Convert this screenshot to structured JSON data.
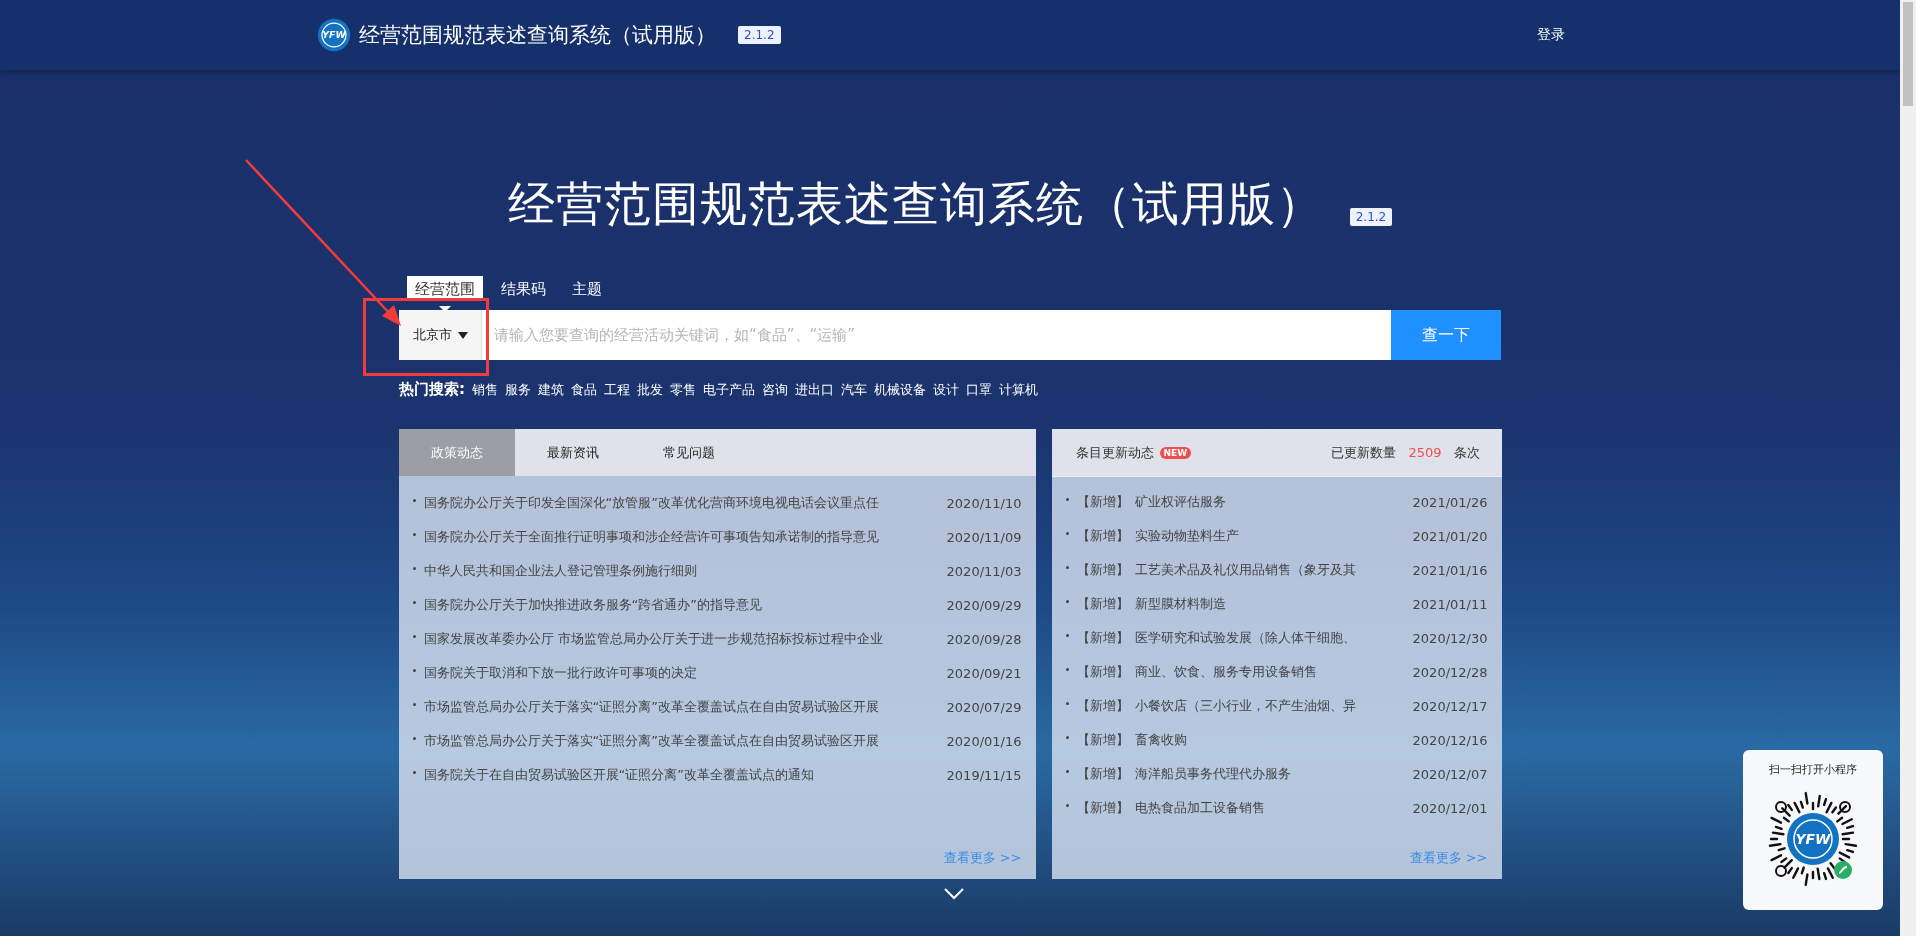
{
  "header": {
    "logo_text": "YFW",
    "title": "经营范围规范表述查询系统（试用版）",
    "version": "2.1.2",
    "login": "登录"
  },
  "hero": {
    "title": "经营范围规范表述查询系统（试用版）",
    "version": "2.1.2"
  },
  "search_tabs": [
    {
      "label": "经营范围",
      "selected": true
    },
    {
      "label": "结果码",
      "selected": false
    },
    {
      "label": "主题",
      "selected": false
    }
  ],
  "search": {
    "city": "北京市",
    "placeholder": "请输入您要查询的经营活动关键词，如“食品”、“运输”",
    "button": "查一下"
  },
  "hot_search": {
    "label": "热门搜索:",
    "keywords": [
      "销售",
      "服务",
      "建筑",
      "食品",
      "工程",
      "批发",
      "零售",
      "电子产品",
      "咨询",
      "进出口",
      "汽车",
      "机械设备",
      "设计",
      "口罩",
      "计算机"
    ]
  },
  "news_panel": {
    "tabs": [
      {
        "label": "政策动态",
        "selected": true
      },
      {
        "label": "最新资讯",
        "selected": false
      },
      {
        "label": "常见问题",
        "selected": false
      }
    ],
    "items": [
      {
        "title": "国务院办公厅关于印发全国深化“放管服”改革优化营商环境电视电话会议重点任",
        "date": "2020/11/10"
      },
      {
        "title": "国务院办公厅关于全面推行证明事项和涉企经营许可事项告知承诺制的指导意见",
        "date": "2020/11/09"
      },
      {
        "title": "中华人民共和国企业法人登记管理条例施行细则",
        "date": "2020/11/03"
      },
      {
        "title": "国务院办公厅关于加快推进政务服务“跨省通办”的指导意见",
        "date": "2020/09/29"
      },
      {
        "title": "国家发展改革委办公厅 市场监管总局办公厅关于进一步规范招标投标过程中企业",
        "date": "2020/09/28"
      },
      {
        "title": "国务院关于取消和下放一批行政许可事项的决定",
        "date": "2020/09/21"
      },
      {
        "title": "市场监管总局办公厅关于落实“证照分离”改革全覆盖试点在自由贸易试验区开展",
        "date": "2020/07/29"
      },
      {
        "title": "市场监管总局办公厅关于落实“证照分离”改革全覆盖试点在自由贸易试验区开展",
        "date": "2020/01/16"
      },
      {
        "title": "国务院关于在自由贸易试验区开展“证照分离”改革全覆盖试点的通知",
        "date": "2019/11/15"
      }
    ],
    "more": "查看更多 >>"
  },
  "update_panel": {
    "title": "条目更新动态",
    "badge": "NEW",
    "count_label": "已更新数量",
    "count": "2509",
    "count_unit": "条次",
    "items": [
      {
        "tag": "【新增】",
        "title": "矿业权评估服务",
        "date": "2021/01/26"
      },
      {
        "tag": "【新增】",
        "title": "实验动物垫料生产",
        "date": "2021/01/20"
      },
      {
        "tag": "【新增】",
        "title": "工艺美术品及礼仪用品销售（象牙及其",
        "date": "2021/01/16"
      },
      {
        "tag": "【新增】",
        "title": "新型膜材料制造",
        "date": "2021/01/11"
      },
      {
        "tag": "【新增】",
        "title": "医学研究和试验发展（除人体干细胞、",
        "date": "2020/12/30"
      },
      {
        "tag": "【新增】",
        "title": "商业、饮食、服务专用设备销售",
        "date": "2020/12/28"
      },
      {
        "tag": "【新增】",
        "title": "小餐饮店（三小行业，不产生油烟、异",
        "date": "2020/12/17"
      },
      {
        "tag": "【新增】",
        "title": "畜禽收购",
        "date": "2020/12/16"
      },
      {
        "tag": "【新增】",
        "title": "海洋船员事务代理代办服务",
        "date": "2020/12/07"
      },
      {
        "tag": "【新增】",
        "title": "电热食品加工设备销售",
        "date": "2020/12/01"
      }
    ],
    "more": "查看更多 >>"
  },
  "qr_card": {
    "caption": "扫一扫打开小程序",
    "logo_text": "YFW"
  }
}
